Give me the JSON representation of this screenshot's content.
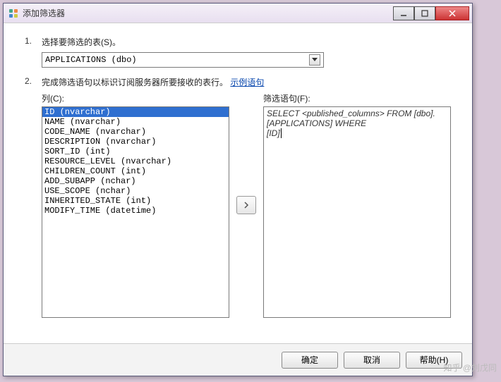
{
  "window": {
    "title": "添加筛选器"
  },
  "step1": {
    "num": "1.",
    "text": "选择要筛选的表(S)。",
    "dropdown": "APPLICATIONS (dbo)"
  },
  "step2": {
    "num": "2.",
    "text_prefix": "完成筛选语句以标识订阅服务器所要接收的表行。",
    "link": "示例语句"
  },
  "columns": {
    "label": "列(C):",
    "items": [
      "ID (nvarchar)",
      "NAME (nvarchar)",
      "CODE_NAME (nvarchar)",
      "DESCRIPTION (nvarchar)",
      "SORT_ID (int)",
      "RESOURCE_LEVEL (nvarchar)",
      "CHILDREN_COUNT (int)",
      "ADD_SUBAPP (nchar)",
      "USE_SCOPE (nchar)",
      "INHERITED_STATE (int)",
      "MODIFY_TIME (datetime)"
    ]
  },
  "filter": {
    "label": "筛选语句(F):",
    "line1": "SELECT <published_columns> FROM [dbo].[APPLICATIONS] WHERE",
    "line2": "[ID]"
  },
  "buttons": {
    "ok": "确定",
    "cancel": "取消",
    "help": "帮助(H)"
  },
  "watermark": "知乎 @刘戊同"
}
